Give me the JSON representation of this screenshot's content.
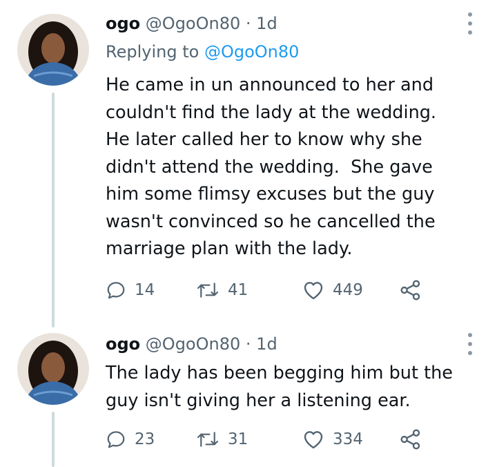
{
  "tweets": [
    {
      "name": "ogo",
      "handle": "@OgoOn80",
      "separator": "·",
      "time": "1d",
      "replying_prefix": "Replying to",
      "replying_handle": "@OgoOn80",
      "text": "He came in un announced to her and\ncouldn't find the lady at the wedding.\nHe later called her to know why she\ndidn't attend the wedding.  She gave\nhim some flimsy excuses but the guy\nwasn't convinced so he cancelled the\nmarriage plan with the lady.",
      "replies": "14",
      "retweets": "41",
      "likes": "449"
    },
    {
      "name": "ogo",
      "handle": "@OgoOn80",
      "separator": "·",
      "time": "1d",
      "text": "The lady has been begging him but the\nguy isn't giving her a listening ear.",
      "replies": "23",
      "retweets": "31",
      "likes": "334"
    }
  ],
  "icons": {
    "reply": "reply-icon",
    "retweet": "retweet-icon",
    "like": "heart-icon",
    "share": "share-icon",
    "more": "more-options-icon"
  },
  "colors": {
    "text": "#0f1419",
    "secondary": "#536471",
    "link": "#1d9bf0",
    "thread_line": "#cfd9de"
  }
}
